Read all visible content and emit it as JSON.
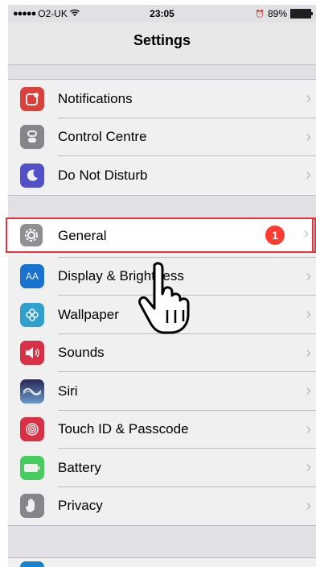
{
  "status": {
    "signal_dots": "●●●●●",
    "carrier": "O2-UK",
    "time": "23:05",
    "alarm": "⏰",
    "battery": "89%"
  },
  "nav": {
    "title": "Settings"
  },
  "groups": [
    {
      "items": [
        {
          "label": "Notifications",
          "icon": "notifications-icon",
          "color": "#e8463e"
        },
        {
          "label": "Control Centre",
          "icon": "control-centre-icon",
          "color": "#8e8e93"
        },
        {
          "label": "Do Not Disturb",
          "icon": "moon-icon",
          "color": "#5856d6"
        }
      ]
    },
    {
      "items": [
        {
          "label": "General",
          "icon": "gear-icon",
          "color": "#8e8e93",
          "badge": "1"
        },
        {
          "label": "Display & Brightness",
          "icon": "display-icon",
          "color": "#1a7bdc",
          "glyph": "AA"
        },
        {
          "label": "Wallpaper",
          "icon": "wallpaper-icon",
          "color": "#35aadc"
        },
        {
          "label": "Sounds",
          "icon": "speaker-icon",
          "color": "#e8334a"
        },
        {
          "label": "Siri",
          "icon": "siri-icon",
          "color": "#3a3a6a"
        },
        {
          "label": "Touch ID & Passcode",
          "icon": "fingerprint-icon",
          "color": "#e8334a"
        },
        {
          "label": "Battery",
          "icon": "battery-icon",
          "color": "#4cd964"
        },
        {
          "label": "Privacy",
          "icon": "hand-icon",
          "color": "#8e8e93"
        }
      ]
    }
  ],
  "colors": {
    "highlight": "#e8333f",
    "badge": "#ff3b30",
    "background": "#efeff4"
  }
}
